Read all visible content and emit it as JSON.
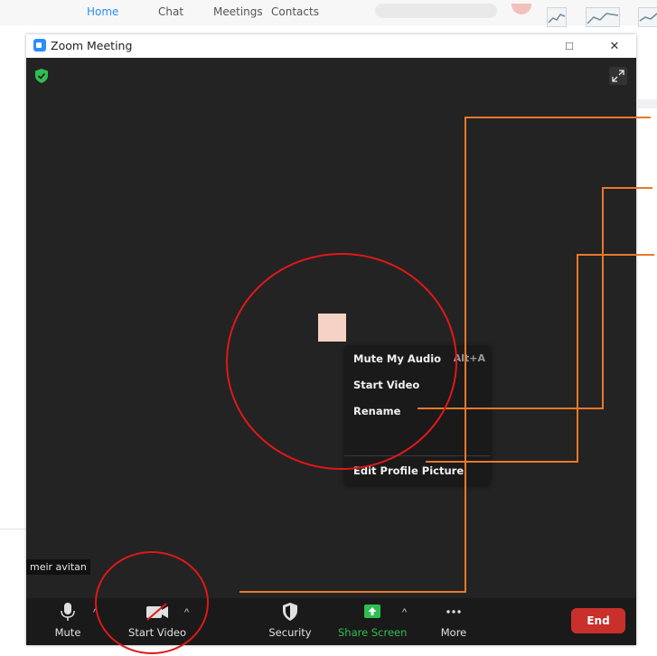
{
  "background_app": {
    "tabs": [
      "Home",
      "Chat",
      "Meetings",
      "Contacts"
    ]
  },
  "window": {
    "title": "Zoom Meeting",
    "controls": [
      "□",
      "✕"
    ]
  },
  "participant": {
    "name": "meir avitan"
  },
  "context_menu": {
    "items": [
      {
        "label": "Mute My Audio",
        "shortcut": "Alt+A"
      },
      {
        "label": "Start Video"
      },
      {
        "label": "Rename"
      },
      {
        "label": "Edit Profile Picture"
      }
    ]
  },
  "toolbar": {
    "mute_label": "Mute",
    "video_label": "Start Video",
    "security_label": "Security",
    "share_label": "Share Screen",
    "more_label": "More",
    "end_label": "End"
  },
  "colors": {
    "meeting_bg": "#232323",
    "toolbar_bg": "#1a1a1a",
    "share_green": "#2fbe4f",
    "end_red": "#c9302c",
    "annotation_red": "#e01818",
    "annotation_orange": "#e8782a",
    "zoom_blue": "#2d8cff"
  },
  "icons": [
    "shield-icon",
    "fullscreen-icon",
    "microphone-icon",
    "video-off-icon",
    "security-shield-icon",
    "share-screen-icon",
    "more-dots-icon",
    "chevron-up-icon"
  ]
}
